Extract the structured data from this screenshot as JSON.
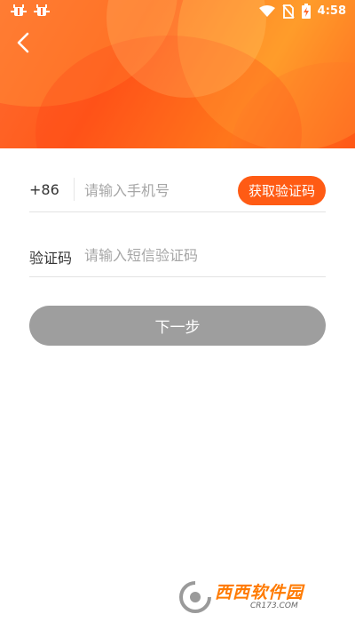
{
  "status_bar": {
    "app_icons": [
      "bug-icon",
      "bug-icon"
    ],
    "time": "4:58",
    "icons": [
      "wifi-icon",
      "no-sim-icon",
      "battery-charging-icon"
    ]
  },
  "header": {
    "back_icon": "chevron-left-icon",
    "colors": {
      "primary": "#ff5a1a",
      "light": "#ff8a1e"
    }
  },
  "form": {
    "phone": {
      "country_code": "+86",
      "placeholder": "请输入手机号",
      "value": ""
    },
    "get_code_label": "获取验证码",
    "code": {
      "label": "验证码",
      "placeholder": "请输入短信验证码",
      "value": ""
    }
  },
  "next_button": {
    "label": "下一步",
    "color": "#9e9e9e"
  },
  "watermark": {
    "text": "西西软件园",
    "sub": "CR173.COM"
  },
  "colors": {
    "accent": "#ff5b14",
    "divider": "#e3e3e3",
    "placeholder": "#a6a6a6"
  }
}
